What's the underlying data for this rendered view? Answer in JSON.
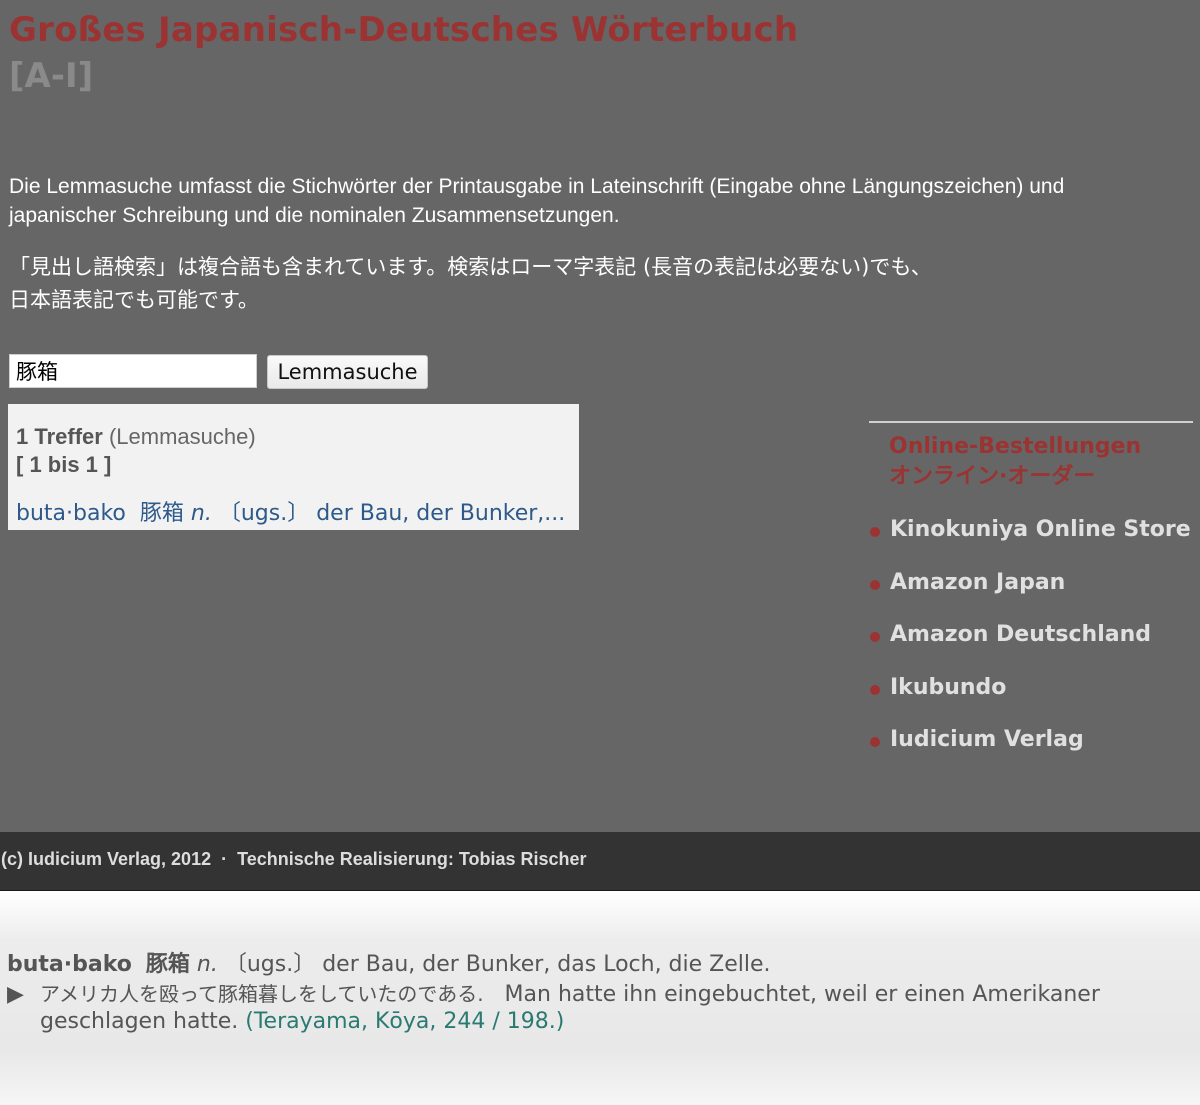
{
  "header": {
    "title": "Großes Japanisch-Deutsches Wörterbuch",
    "subtitle": "[A-I]"
  },
  "intro": {
    "german": "Die Lemmasuche umfasst die Stichwörter der Printausgabe in Lateinschrift (Eingabe ohne Längungszeichen) und japanischer Schreibung und die nominalen Zusammensetzungen.",
    "japanese_line1": "「見出し語検索」は複合語も含まれています。検索はローマ字表記 (長音の表記は必要ない)でも、",
    "japanese_line2": "日本語表記でも可能です。"
  },
  "search": {
    "value": "豚箱",
    "button_label": "Lemmasuche"
  },
  "results": {
    "count_label": "1 Treffer",
    "mode_label": "(Lemmasuche)",
    "range_label": "[ 1 bis 1 ]",
    "hit": {
      "romaji": "buta·bako",
      "kanji": "豚箱",
      "pos": "n.",
      "register": "〔ugs.〕",
      "gloss": "der Bau, der Bunker,..."
    }
  },
  "sidebar": {
    "title_de": "Online-Bestellungen",
    "title_ja": "オンライン·オーダー",
    "shops": [
      "Kinokuniya Online Store",
      "Amazon Japan",
      "Amazon Deutschland",
      "Ikubundo",
      "Iudicium Verlag"
    ]
  },
  "footer": {
    "text": "(c) Iudicium Verlag, 2012  ·  Technische Realisierung: Tobias Rischer"
  },
  "entry": {
    "romaji": "buta·bako",
    "kanji": "豚箱",
    "pos": "n.",
    "register": "〔ugs.〕",
    "gloss": "der Bau, der Bunker, das Loch, die Zelle.",
    "example_marker": "▶",
    "example_ja": "アメリカ人を殴って豚箱暮しをしていたのである.",
    "example_de_part1": "Man hatte ihn eingebuchtet, weil er einen Amerikaner",
    "example_de_part2": "geschlagen hatte.",
    "source": "(Terayama, Kōya, 244 / 198.)"
  },
  "colors": {
    "background": "#666666",
    "title": "#9c3333",
    "link": "#2d5a8a",
    "source": "#2a7a72",
    "footer": "#333333"
  }
}
